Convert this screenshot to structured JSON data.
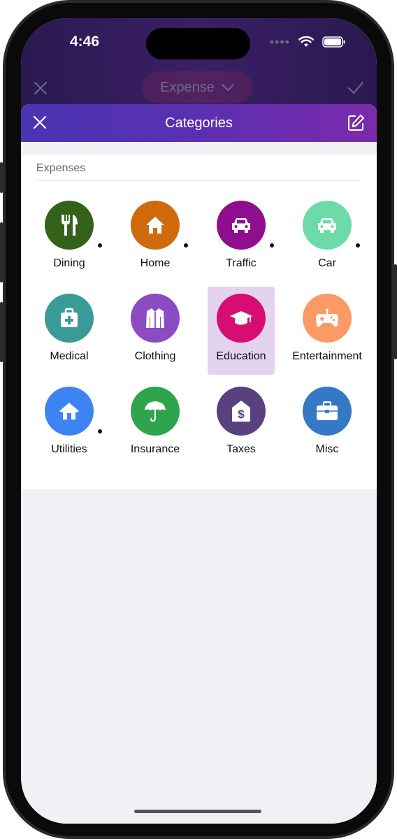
{
  "status_bar": {
    "time": "4:46"
  },
  "background_app": {
    "type_selector_label": "Expense"
  },
  "sheet": {
    "title": "Categories"
  },
  "section": {
    "label": "Expenses"
  },
  "categories": [
    {
      "label": "Dining",
      "color": "#35621b",
      "icon": "dining-icon",
      "dot": true
    },
    {
      "label": "Home",
      "color": "#cf6b0c",
      "icon": "home-icon",
      "dot": true
    },
    {
      "label": "Traffic",
      "color": "#8f0d8f",
      "icon": "car-icon",
      "dot": true
    },
    {
      "label": "Car",
      "color": "#6ddba8",
      "icon": "car-icon",
      "dot": true
    },
    {
      "label": "Medical",
      "color": "#3a9a97",
      "icon": "medical-kit-icon",
      "dot": false
    },
    {
      "label": "Clothing",
      "color": "#8b4bc2",
      "icon": "jacket-icon",
      "dot": false
    },
    {
      "label": "Education",
      "color": "#d80d72",
      "icon": "graduation-cap-icon",
      "dot": false,
      "selected": true
    },
    {
      "label": "Entertainment",
      "color": "#fb9a66",
      "icon": "gamepad-icon",
      "dot": false
    },
    {
      "label": "Utilities",
      "color": "#3e83f2",
      "icon": "house-utilities-icon",
      "dot": true
    },
    {
      "label": "Insurance",
      "color": "#2fa44d",
      "icon": "umbrella-icon",
      "dot": false
    },
    {
      "label": "Taxes",
      "color": "#59407e",
      "icon": "tax-house-icon",
      "dot": false
    },
    {
      "label": "Misc",
      "color": "#3379c6",
      "icon": "briefcase-icon",
      "dot": false
    }
  ]
}
